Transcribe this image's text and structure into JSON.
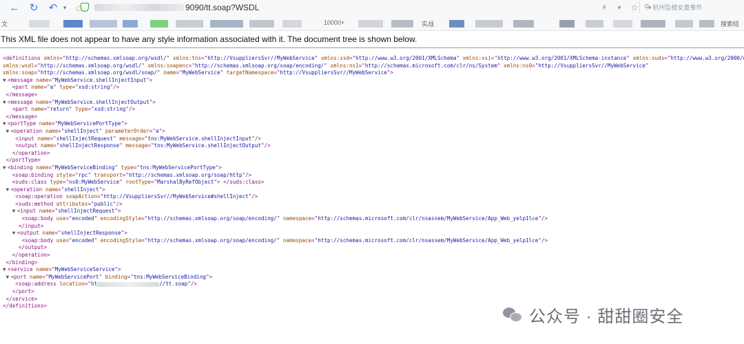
{
  "browser": {
    "url_suffix": "9090/tt.soap?WSDL",
    "search_placeholder": "杭州坠楼女童事件",
    "bookmark_labels": [
      "文",
      "10000+",
      "实战",
      "搜索结"
    ],
    "icons": [
      "back-arrow-icon",
      "refresh-icon",
      "history-back-icon",
      "dropdown-icon",
      "home-icon",
      "security-shield-icon",
      "lightning-icon",
      "star-icon",
      "chevron-down-icon",
      "search-icon"
    ]
  },
  "page": {
    "notice": "This XML file does not appear to have any style information associated with it. The document tree is shown below.",
    "lines": [
      [
        [
          "t",
          "<definitions "
        ],
        [
          "n",
          "xmlns"
        ],
        [
          "t",
          "=\""
        ],
        [
          "v",
          "http://schemas.xmlsoap.org/wsdl/"
        ],
        [
          "t",
          "\" "
        ],
        [
          "n",
          "xmlns:tns"
        ],
        [
          "t",
          "=\""
        ],
        [
          "v",
          "http://VsuppliersSvr//MyWebService"
        ],
        [
          "t",
          "\" "
        ],
        [
          "n",
          "xmlns:xsd"
        ],
        [
          "t",
          "=\""
        ],
        [
          "v",
          "http://www.w3.org/2001/XMLSchema"
        ],
        [
          "t",
          "\" "
        ],
        [
          "n",
          "xmlns:xsi"
        ],
        [
          "t",
          "=\""
        ],
        [
          "v",
          "http://www.w3.org/2001/XMLSchema-instance"
        ],
        [
          "t",
          "\" "
        ],
        [
          "n",
          "xmlns:suds"
        ],
        [
          "t",
          "=\""
        ],
        [
          "v",
          "http://www.w3.org/2000/wsdl/suds"
        ]
      ],
      [
        [
          "n",
          "xmlns:wsdl"
        ],
        [
          "t",
          "=\""
        ],
        [
          "v",
          "http://schemas.xmlsoap.org/wsdl/"
        ],
        [
          "t",
          "\" "
        ],
        [
          "n",
          "xmlns:soapenc"
        ],
        [
          "t",
          "=\""
        ],
        [
          "v",
          "http://schemas.xmlsoap.org/soap/encoding/"
        ],
        [
          "t",
          "\" "
        ],
        [
          "n",
          "xmlns:ns1"
        ],
        [
          "t",
          "=\""
        ],
        [
          "v",
          "http://schemas.microsoft.com/clr/ns/System"
        ],
        [
          "t",
          "\" "
        ],
        [
          "n",
          "xmlns:ns0"
        ],
        [
          "t",
          "=\""
        ],
        [
          "v",
          "http://VsuppliersSvr//MyWebService"
        ],
        [
          "t",
          "\""
        ]
      ],
      [
        [
          "n",
          "xmlns:soap"
        ],
        [
          "t",
          "=\""
        ],
        [
          "v",
          "http://schemas.xmlsoap.org/wsdl/soap/"
        ],
        [
          "t",
          "\" "
        ],
        [
          "n",
          "name"
        ],
        [
          "t",
          "=\""
        ],
        [
          "v",
          "MyWebService"
        ],
        [
          "t",
          "\" "
        ],
        [
          "n",
          "targetNamespace"
        ],
        [
          "t",
          "=\""
        ],
        [
          "v",
          "http://VsuppliersSvr//MyWebService"
        ],
        [
          "t",
          "\">"
        ]
      ],
      [
        [
          "g",
          "▼"
        ],
        [
          "t",
          "<message "
        ],
        [
          "n",
          "name"
        ],
        [
          "t",
          "=\""
        ],
        [
          "v",
          "MyWebService.shellInjectInput"
        ],
        [
          "t",
          "\">"
        ]
      ],
      [
        [
          "s",
          "   "
        ],
        [
          "t",
          "<part "
        ],
        [
          "n",
          "name"
        ],
        [
          "t",
          "=\""
        ],
        [
          "v",
          "a"
        ],
        [
          "t",
          "\" "
        ],
        [
          "n",
          "type"
        ],
        [
          "t",
          "=\""
        ],
        [
          "v",
          "xsd:string"
        ],
        [
          "t",
          "\"/>"
        ]
      ],
      [
        [
          "s",
          " "
        ],
        [
          "t",
          "</message>"
        ]
      ],
      [
        [
          "g",
          "▼"
        ],
        [
          "t",
          "<message "
        ],
        [
          "n",
          "name"
        ],
        [
          "t",
          "=\""
        ],
        [
          "v",
          "MyWebService.shellInjectOutput"
        ],
        [
          "t",
          "\">"
        ]
      ],
      [
        [
          "s",
          "   "
        ],
        [
          "t",
          "<part "
        ],
        [
          "n",
          "name"
        ],
        [
          "t",
          "=\""
        ],
        [
          "v",
          "return"
        ],
        [
          "t",
          "\" "
        ],
        [
          "n",
          "type"
        ],
        [
          "t",
          "=\""
        ],
        [
          "v",
          "xsd:string"
        ],
        [
          "t",
          "\"/>"
        ]
      ],
      [
        [
          "s",
          " "
        ],
        [
          "t",
          "</message>"
        ]
      ],
      [
        [
          "g",
          "▼"
        ],
        [
          "t",
          "<portType "
        ],
        [
          "n",
          "name"
        ],
        [
          "t",
          "=\""
        ],
        [
          "v",
          "MyWebServicePortType"
        ],
        [
          "t",
          "\">"
        ]
      ],
      [
        [
          "s",
          " "
        ],
        [
          "g",
          "▼"
        ],
        [
          "t",
          "<operation "
        ],
        [
          "n",
          "name"
        ],
        [
          "t",
          "=\""
        ],
        [
          "v",
          "shellInject"
        ],
        [
          "t",
          "\" "
        ],
        [
          "n",
          "parameterOrder"
        ],
        [
          "t",
          "=\""
        ],
        [
          "v",
          "a"
        ],
        [
          "t",
          "\">"
        ]
      ],
      [
        [
          "s",
          "    "
        ],
        [
          "t",
          "<input "
        ],
        [
          "n",
          "name"
        ],
        [
          "t",
          "=\""
        ],
        [
          "v",
          "shellInjectRequest"
        ],
        [
          "t",
          "\" "
        ],
        [
          "n",
          "message"
        ],
        [
          "t",
          "=\""
        ],
        [
          "v",
          "tns:MyWebService.shellInjectInput"
        ],
        [
          "t",
          "\"/>"
        ]
      ],
      [
        [
          "s",
          "    "
        ],
        [
          "t",
          "<output "
        ],
        [
          "n",
          "name"
        ],
        [
          "t",
          "=\""
        ],
        [
          "v",
          "shellInjectResponse"
        ],
        [
          "t",
          "\" "
        ],
        [
          "n",
          "message"
        ],
        [
          "t",
          "=\""
        ],
        [
          "v",
          "tns:MyWebService.shellInjectOutput"
        ],
        [
          "t",
          "\"/>"
        ]
      ],
      [
        [
          "s",
          "   "
        ],
        [
          "t",
          "</operation>"
        ]
      ],
      [
        [
          "s",
          " "
        ],
        [
          "t",
          "</portType>"
        ]
      ],
      [
        [
          "g",
          "▼"
        ],
        [
          "t",
          "<binding "
        ],
        [
          "n",
          "name"
        ],
        [
          "t",
          "=\""
        ],
        [
          "v",
          "MyWebServiceBinding"
        ],
        [
          "t",
          "\" "
        ],
        [
          "n",
          "type"
        ],
        [
          "t",
          "=\""
        ],
        [
          "v",
          "tns:MyWebServicePortType"
        ],
        [
          "t",
          "\">"
        ]
      ],
      [
        [
          "s",
          "   "
        ],
        [
          "t",
          "<soap:binding "
        ],
        [
          "n",
          "style"
        ],
        [
          "t",
          "=\""
        ],
        [
          "v",
          "rpc"
        ],
        [
          "t",
          "\" "
        ],
        [
          "n",
          "transport"
        ],
        [
          "t",
          "=\""
        ],
        [
          "v",
          "http://schemas.xmlsoap.org/soap/http"
        ],
        [
          "t",
          "\"/>"
        ]
      ],
      [
        [
          "s",
          "   "
        ],
        [
          "t",
          "<suds:class "
        ],
        [
          "n",
          "type"
        ],
        [
          "t",
          "=\""
        ],
        [
          "v",
          "ns0:MyWebService"
        ],
        [
          "t",
          "\" "
        ],
        [
          "n",
          "rootType"
        ],
        [
          "t",
          "=\""
        ],
        [
          "v",
          "MarshalByRefObject"
        ],
        [
          "t",
          "\"> </suds:class>"
        ]
      ],
      [
        [
          "s",
          " "
        ],
        [
          "g",
          "▼"
        ],
        [
          "t",
          "<operation "
        ],
        [
          "n",
          "name"
        ],
        [
          "t",
          "=\""
        ],
        [
          "v",
          "shellInject"
        ],
        [
          "t",
          "\">"
        ]
      ],
      [
        [
          "s",
          "    "
        ],
        [
          "t",
          "<soap:operation "
        ],
        [
          "n",
          "soapAction"
        ],
        [
          "t",
          "=\""
        ],
        [
          "v",
          "http://VsuppliersSvr//MyWebService#shellInject"
        ],
        [
          "t",
          "\"/>"
        ]
      ],
      [
        [
          "s",
          "    "
        ],
        [
          "t",
          "<suds:method "
        ],
        [
          "n",
          "attributes"
        ],
        [
          "t",
          "=\""
        ],
        [
          "v",
          "public"
        ],
        [
          "t",
          "\"/>"
        ]
      ],
      [
        [
          "s",
          "   "
        ],
        [
          "g",
          "▼"
        ],
        [
          "t",
          "<input "
        ],
        [
          "n",
          "name"
        ],
        [
          "t",
          "=\""
        ],
        [
          "v",
          "shellInjectRequest"
        ],
        [
          "t",
          "\">"
        ]
      ],
      [
        [
          "s",
          "      "
        ],
        [
          "t",
          "<soap:body "
        ],
        [
          "n",
          "use"
        ],
        [
          "t",
          "=\""
        ],
        [
          "v",
          "encoded"
        ],
        [
          "t",
          "\" "
        ],
        [
          "n",
          "encodingStyle"
        ],
        [
          "t",
          "=\""
        ],
        [
          "v",
          "http://schemas.xmlsoap.org/soap/encoding/"
        ],
        [
          "t",
          "\" "
        ],
        [
          "n",
          "namespace"
        ],
        [
          "t",
          "=\""
        ],
        [
          "v",
          "http://schemas.microsoft.com/clr/nsassem/MyWebService/App_Web_yelp1lce"
        ],
        [
          "t",
          "\"/>"
        ]
      ],
      [
        [
          "s",
          "     "
        ],
        [
          "t",
          "</input>"
        ]
      ],
      [
        [
          "s",
          "   "
        ],
        [
          "g",
          "▼"
        ],
        [
          "t",
          "<output "
        ],
        [
          "n",
          "name"
        ],
        [
          "t",
          "=\""
        ],
        [
          "v",
          "shellInjectResponse"
        ],
        [
          "t",
          "\">"
        ]
      ],
      [
        [
          "s",
          "      "
        ],
        [
          "t",
          "<soap:body "
        ],
        [
          "n",
          "use"
        ],
        [
          "t",
          "=\""
        ],
        [
          "v",
          "encoded"
        ],
        [
          "t",
          "\" "
        ],
        [
          "n",
          "encodingStyle"
        ],
        [
          "t",
          "=\""
        ],
        [
          "v",
          "http://schemas.xmlsoap.org/soap/encoding/"
        ],
        [
          "t",
          "\" "
        ],
        [
          "n",
          "namespace"
        ],
        [
          "t",
          "=\""
        ],
        [
          "v",
          "http://schemas.microsoft.com/clr/nsassem/MyWebService/App_Web_yelp1lce"
        ],
        [
          "t",
          "\"/>"
        ]
      ],
      [
        [
          "s",
          "     "
        ],
        [
          "t",
          "</output>"
        ]
      ],
      [
        [
          "s",
          "   "
        ],
        [
          "t",
          "</operation>"
        ]
      ],
      [
        [
          "s",
          " "
        ],
        [
          "t",
          "</binding>"
        ]
      ],
      [
        [
          "g",
          "▼"
        ],
        [
          "t",
          "<service "
        ],
        [
          "n",
          "name"
        ],
        [
          "t",
          "=\""
        ],
        [
          "v",
          "MyWebServiceService"
        ],
        [
          "t",
          "\">"
        ]
      ],
      [
        [
          "s",
          " "
        ],
        [
          "g",
          "▼"
        ],
        [
          "t",
          "<port "
        ],
        [
          "n",
          "name"
        ],
        [
          "t",
          "=\""
        ],
        [
          "v",
          "MyWebServicePort"
        ],
        [
          "t",
          "\" "
        ],
        [
          "n",
          "binding"
        ],
        [
          "t",
          "=\""
        ],
        [
          "v",
          "tns:MyWebServiceBinding"
        ],
        [
          "t",
          "\">"
        ]
      ],
      [
        [
          "s",
          "    "
        ],
        [
          "t",
          "<soap:address "
        ],
        [
          "n",
          "location"
        ],
        [
          "t",
          "=\""
        ],
        [
          "v",
          "ht"
        ],
        [
          "b",
          ""
        ],
        [
          "v",
          "//tt.soap"
        ],
        [
          "t",
          "\"/>"
        ]
      ],
      [
        [
          "s",
          "   "
        ],
        [
          "t",
          "</port>"
        ]
      ],
      [
        [
          "s",
          " "
        ],
        [
          "t",
          "</service>"
        ]
      ],
      [
        [
          "t",
          "</definitions>"
        ]
      ]
    ]
  },
  "watermark": {
    "text": "公众号 · 甜甜圈安全"
  }
}
